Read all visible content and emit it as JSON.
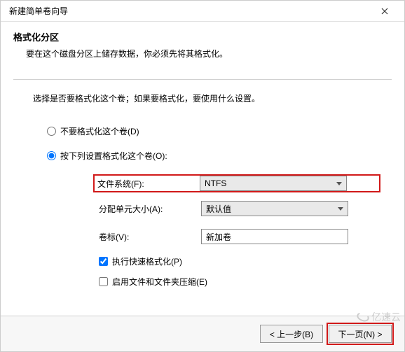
{
  "titlebar": {
    "title": "新建简单卷向导"
  },
  "header": {
    "section_title": "格式化分区",
    "section_desc": "要在这个磁盘分区上储存数据，你必须先将其格式化。"
  },
  "instruction": "选择是否要格式化这个卷；如果要格式化，要使用什么设置。",
  "radios": {
    "no_format": "不要格式化这个卷(D)",
    "format_with": "按下列设置格式化这个卷(O):"
  },
  "fields": {
    "filesystem_label": "文件系统(F):",
    "filesystem_value": "NTFS",
    "alloc_label": "分配单元大小(A):",
    "alloc_value": "默认值",
    "volume_label": "卷标(V):",
    "volume_value": "新加卷"
  },
  "checks": {
    "quick_format": "执行快速格式化(P)",
    "compress": "启用文件和文件夹压缩(E)"
  },
  "footer": {
    "back": "< 上一步(B)",
    "next": "下一页(N) >",
    "cancel": ""
  },
  "watermark": "亿速云"
}
